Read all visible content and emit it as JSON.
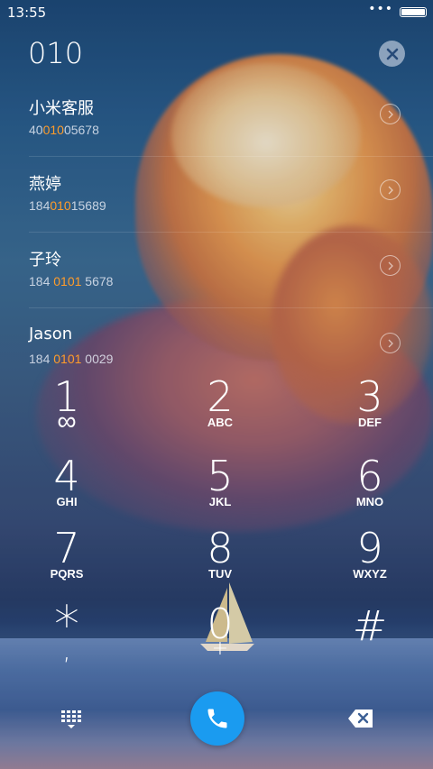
{
  "status_bar": {
    "time": "13:55",
    "more": "•••",
    "battery_icon": "battery-full-icon"
  },
  "dialer": {
    "input": "010",
    "clear_icon": "close-icon"
  },
  "contacts": [
    {
      "name": "小米客服",
      "number_pre": "40",
      "number_match": "010",
      "number_post": "05678"
    },
    {
      "name": "燕婷",
      "number_pre": "184",
      "number_match": "010",
      "number_post": "15689"
    },
    {
      "name": "子玲",
      "number_pre": "184 ",
      "number_match": "0101",
      "number_post": " 5678"
    },
    {
      "name": "Jason",
      "number_pre": "184 ",
      "number_match": "0101",
      "number_post": " 0029"
    }
  ],
  "keypad": {
    "k1": {
      "digit": "1",
      "sub": "∞"
    },
    "k2": {
      "digit": "2",
      "letters": "ABC"
    },
    "k3": {
      "digit": "3",
      "letters": "DEF"
    },
    "k4": {
      "digit": "4",
      "letters": "GHI"
    },
    "k5": {
      "digit": "5",
      "letters": "JKL"
    },
    "k6": {
      "digit": "6",
      "letters": "MNO"
    },
    "k7": {
      "digit": "7",
      "letters": "PQRS"
    },
    "k8": {
      "digit": "8",
      "letters": "TUV"
    },
    "k9": {
      "digit": "9",
      "letters": "WXYZ"
    },
    "kstar": {
      "digit": "*",
      "sub": ","
    },
    "k0": {
      "digit": "0",
      "sub": "+"
    },
    "khash": {
      "digit": "#"
    }
  },
  "bottom_bar": {
    "keypad_icon": "dialpad-icon",
    "call_icon": "phone-icon",
    "backspace_icon": "backspace-icon",
    "call_color": "#1a9bf0"
  },
  "colors": {
    "match_highlight": "#ff9c2a"
  }
}
